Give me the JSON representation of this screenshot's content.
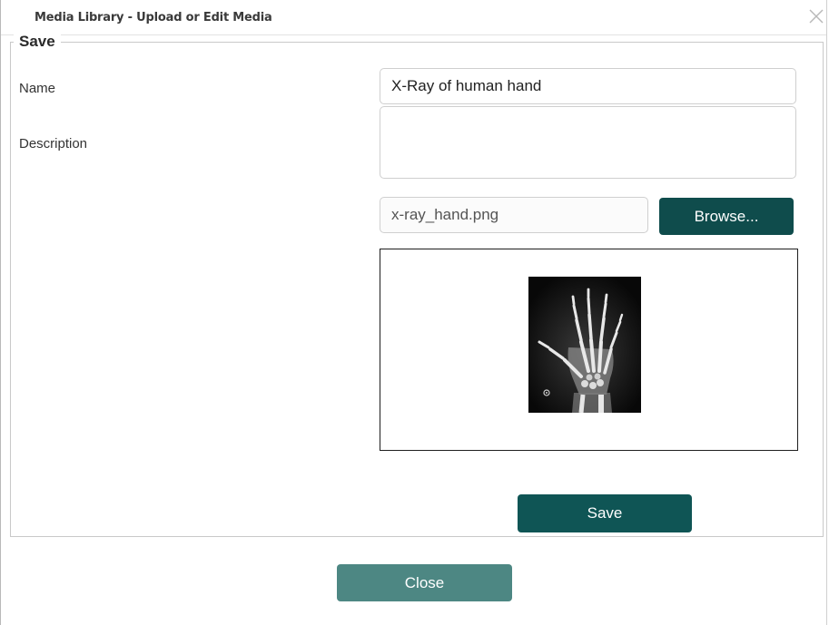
{
  "window": {
    "title": "Media Library - Upload or Edit Media",
    "close_icon": "close-x-icon"
  },
  "form": {
    "legend": "Save",
    "name_label": "Name",
    "name_value": "X-Ray of human hand",
    "description_label": "Description",
    "description_value": "",
    "file_value": "x-ray_hand.png",
    "browse_label": "Browse...",
    "preview_image": "x-ray-hand-image",
    "save_label": "Save"
  },
  "footer": {
    "close_label": "Close"
  },
  "colors": {
    "primary_button": "#0f5555",
    "close_button": "#4d8783"
  }
}
